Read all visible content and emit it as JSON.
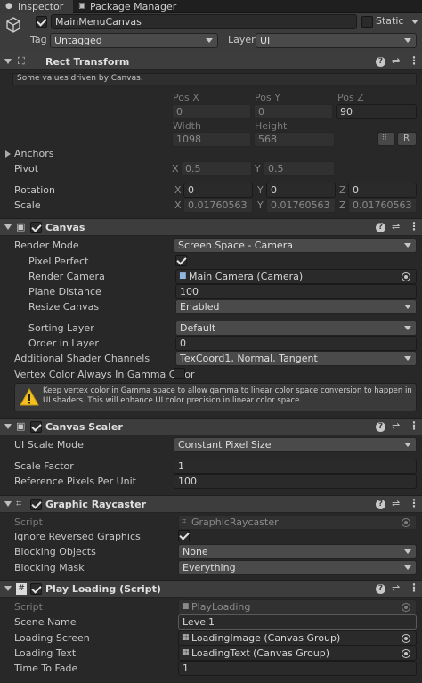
{
  "tabs": {
    "inspector": "Inspector",
    "package_manager": "Package Manager"
  },
  "object": {
    "name": "MainMenuCanvas",
    "static_label": "Static",
    "tag_label": "Tag",
    "tag_value": "Untagged",
    "layer_label": "Layer",
    "layer_value": "UI"
  },
  "rect_transform": {
    "title": "Rect Transform",
    "note": "Some values driven by Canvas.",
    "pos_x_label": "Pos X",
    "pos_y_label": "Pos Y",
    "pos_z_label": "Pos Z",
    "pos_x": "0",
    "pos_y": "0",
    "pos_z": "90",
    "width_label": "Width",
    "height_label": "Height",
    "width": "1098",
    "height": "568",
    "r_button": "R",
    "anchors_label": "Anchors",
    "pivot_label": "Pivot",
    "pivot_x": "0.5",
    "pivot_y": "0.5",
    "rotation_label": "Rotation",
    "rot_x": "0",
    "rot_y": "0",
    "rot_z": "0",
    "scale_label": "Scale",
    "scale_x": "0.01760563",
    "scale_y": "0.01760563",
    "scale_z": "0.01760563",
    "axis_x": "X",
    "axis_y": "Y",
    "axis_z": "Z"
  },
  "canvas": {
    "title": "Canvas",
    "render_mode_label": "Render Mode",
    "render_mode": "Screen Space - Camera",
    "pixel_perfect_label": "Pixel Perfect",
    "render_camera_label": "Render Camera",
    "render_camera": "Main Camera (Camera)",
    "plane_distance_label": "Plane Distance",
    "plane_distance": "100",
    "resize_canvas_label": "Resize Canvas",
    "resize_canvas": "Enabled",
    "sorting_layer_label": "Sorting Layer",
    "sorting_layer": "Default",
    "order_in_layer_label": "Order in Layer",
    "order_in_layer": "0",
    "shader_channels_label": "Additional Shader Channels",
    "shader_channels": "TexCoord1, Normal, Tangent",
    "vertex_color_label": "Vertex Color Always In Gamma Color",
    "warning": "Keep vertex color in Gamma space to allow gamma to linear color space conversion to happen in UI shaders. This will enhance UI color precision in linear color space."
  },
  "canvas_scaler": {
    "title": "Canvas Scaler",
    "ui_scale_mode_label": "UI Scale Mode",
    "ui_scale_mode": "Constant Pixel Size",
    "scale_factor_label": "Scale Factor",
    "scale_factor": "1",
    "ref_ppu_label": "Reference Pixels Per Unit",
    "ref_ppu": "100"
  },
  "graphic_raycaster": {
    "title": "Graphic Raycaster",
    "script_label": "Script",
    "script": "GraphicRaycaster",
    "ignore_reversed_label": "Ignore Reversed Graphics",
    "blocking_objects_label": "Blocking Objects",
    "blocking_objects": "None",
    "blocking_mask_label": "Blocking Mask",
    "blocking_mask": "Everything"
  },
  "play_loading": {
    "title": "Play Loading (Script)",
    "script_label": "Script",
    "script": "PlayLoading",
    "scene_name_label": "Scene Name",
    "scene_name": "Level1",
    "loading_screen_label": "Loading Screen",
    "loading_screen": "LoadingImage (Canvas Group)",
    "loading_text_label": "Loading Text",
    "loading_text": "LoadingText (Canvas Group)",
    "time_to_fade_label": "Time To Fade",
    "time_to_fade": "1"
  }
}
